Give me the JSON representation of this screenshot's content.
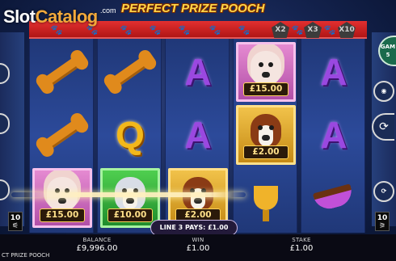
{
  "branding": {
    "watermark_part1": "Slot",
    "watermark_part2": "Catalog",
    "watermark_suffix": ".com"
  },
  "game": {
    "title": "PERFECT PRIZE POOCH",
    "footer_title": "CT PRIZE POOCH"
  },
  "multipliers": [
    "X2",
    "X3",
    "X10"
  ],
  "paw_trail": {
    "lit": [
      true,
      true,
      true,
      true,
      false,
      true,
      true
    ],
    "dim_count": 1
  },
  "reels": [
    [
      {
        "type": "bone"
      },
      {
        "type": "bone"
      },
      {
        "type": "poodle",
        "prize": "£15.00",
        "tile": "pink"
      }
    ],
    [
      {
        "type": "bone"
      },
      {
        "type": "letter",
        "glyph": "Q"
      },
      {
        "type": "husky",
        "prize": "£10.00",
        "tile": "green"
      }
    ],
    [
      {
        "type": "letter",
        "glyph": "A"
      },
      {
        "type": "letter",
        "glyph": "A"
      },
      {
        "type": "stbernard",
        "prize": "£2.00",
        "tile": "gold"
      }
    ],
    [
      {
        "type": "poodle",
        "prize": "£15.00",
        "tile": "pink"
      },
      {
        "type": "stbernard",
        "prize": "£2.00",
        "tile": "gold"
      },
      {
        "type": "trophy"
      }
    ],
    [
      {
        "type": "letter",
        "glyph": "A"
      },
      {
        "type": "letter",
        "glyph": "A"
      },
      {
        "type": "bowl"
      }
    ]
  ],
  "win_banner": "LINE 3 PAYS: £1.00",
  "lines": {
    "left": "10",
    "right": "10"
  },
  "controls": {
    "gamble_label": "GAM 5",
    "spin_icon": "spin-arrow"
  },
  "stats": {
    "balance_label": "BALANCE",
    "balance_value": "£9,996.00",
    "win_label": "WIN",
    "win_value": "£1.00",
    "stake_label": "STAKE",
    "stake_value": "£1.00"
  },
  "colors": {
    "strip_red": "#d82424",
    "prize_gold": "#ffd25a",
    "letter_purple": "#9a48e0",
    "letter_gold": "#f3b81a"
  }
}
